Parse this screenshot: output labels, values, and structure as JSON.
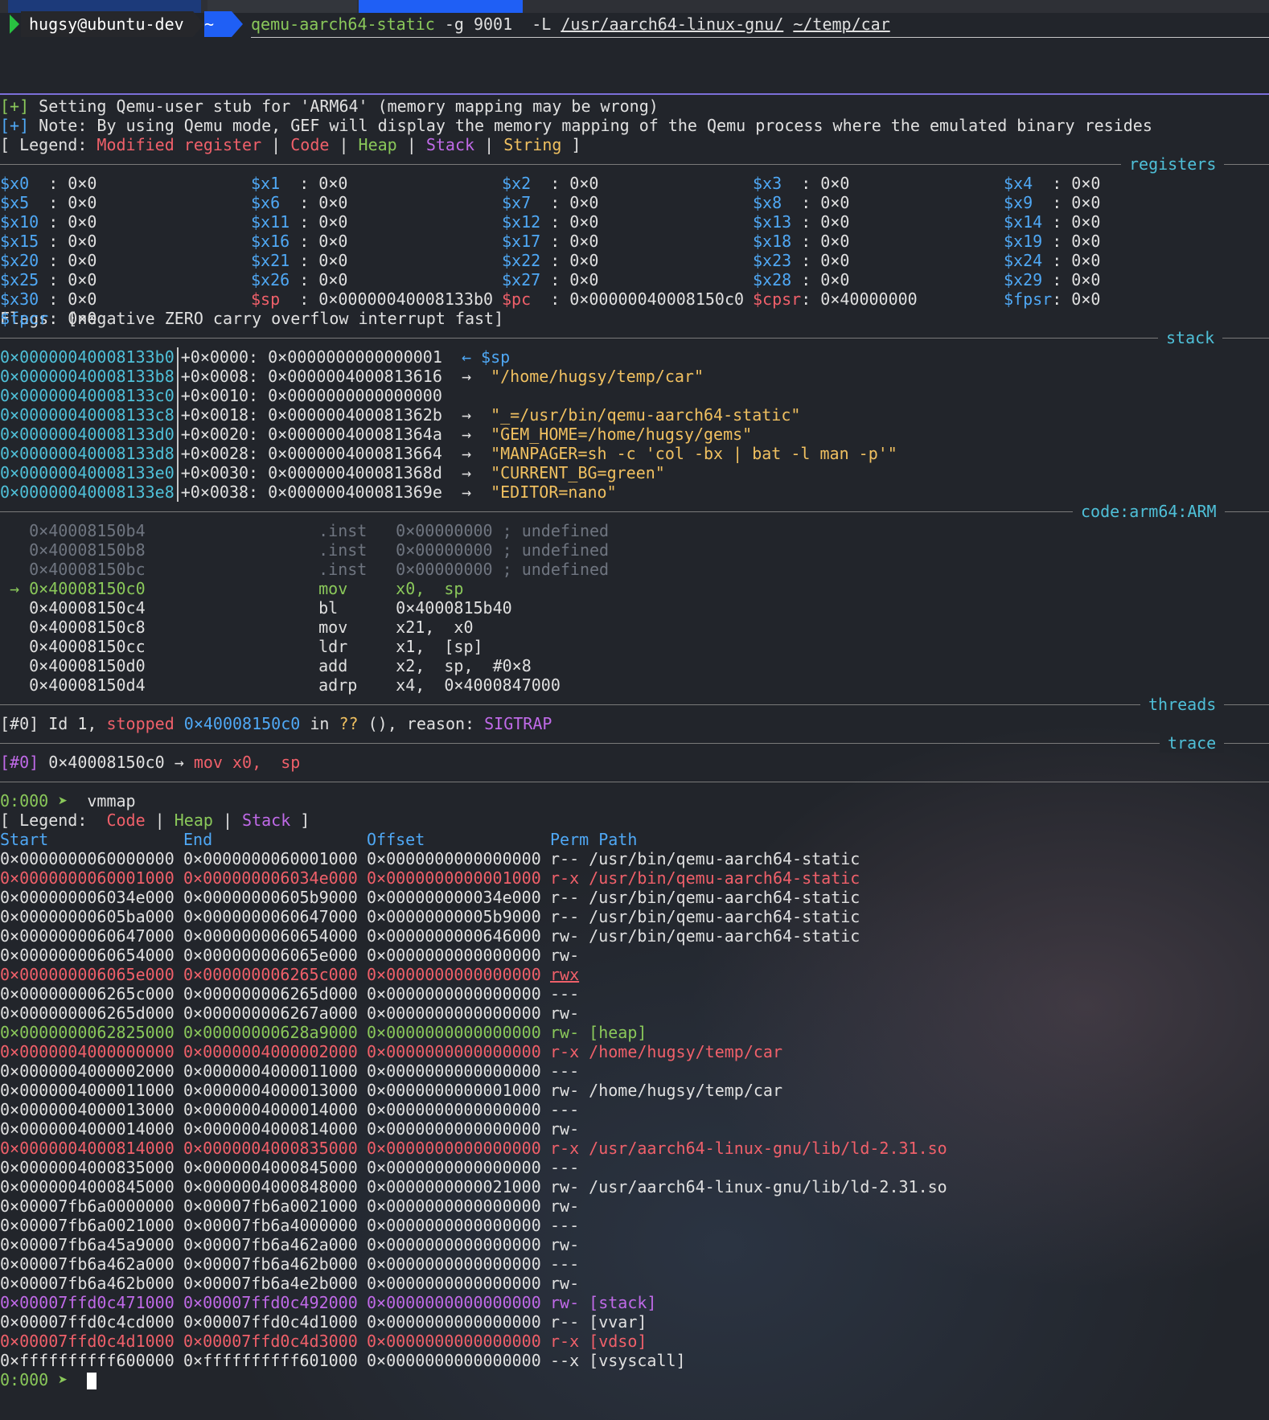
{
  "prompt": {
    "user_host": "hugsy@ubuntu-dev",
    "dir": "~",
    "cmd": "qemu-aarch64-static",
    "args1": " -g 9001  -L ",
    "arg_path1": "/usr/aarch64-linux-gnu/",
    "arg_path2": "~/temp/car"
  },
  "info_lines": [
    {
      "prefix": "[+]",
      "text": " Setting Qemu-user stub for 'ARM64' (memory mapping may be wrong)"
    },
    {
      "prefix": "[+]",
      "text": " Note: By using Qemu mode, GEF will display the memory mapping of the Qemu process where the emulated binary resides"
    }
  ],
  "legend": {
    "open": "[ Legend: ",
    "modified": "Modified register",
    "code": "Code",
    "heap": "Heap",
    "stack": "Stack",
    "string": "String",
    "close": " ]",
    "sep": " | "
  },
  "sections": {
    "registers": "registers",
    "stack": "stack",
    "code": "code:arm64:ARM",
    "threads": "threads",
    "trace": "trace"
  },
  "registers": [
    [
      {
        "n": "$x0  ",
        "v": ": 0×0"
      },
      {
        "n": "$x1  ",
        "v": ": 0×0"
      },
      {
        "n": "$x2  ",
        "v": ": 0×0"
      },
      {
        "n": "$x3  ",
        "v": ": 0×0"
      },
      {
        "n": "$x4  ",
        "v": ": 0×0"
      }
    ],
    [
      {
        "n": "$x5  ",
        "v": ": 0×0"
      },
      {
        "n": "$x6  ",
        "v": ": 0×0"
      },
      {
        "n": "$x7  ",
        "v": ": 0×0"
      },
      {
        "n": "$x8  ",
        "v": ": 0×0"
      },
      {
        "n": "$x9  ",
        "v": ": 0×0"
      }
    ],
    [
      {
        "n": "$x10 ",
        "v": ": 0×0"
      },
      {
        "n": "$x11 ",
        "v": ": 0×0"
      },
      {
        "n": "$x12 ",
        "v": ": 0×0"
      },
      {
        "n": "$x13 ",
        "v": ": 0×0"
      },
      {
        "n": "$x14 ",
        "v": ": 0×0"
      }
    ],
    [
      {
        "n": "$x15 ",
        "v": ": 0×0"
      },
      {
        "n": "$x16 ",
        "v": ": 0×0"
      },
      {
        "n": "$x17 ",
        "v": ": 0×0"
      },
      {
        "n": "$x18 ",
        "v": ": 0×0"
      },
      {
        "n": "$x19 ",
        "v": ": 0×0"
      }
    ],
    [
      {
        "n": "$x20 ",
        "v": ": 0×0"
      },
      {
        "n": "$x21 ",
        "v": ": 0×0"
      },
      {
        "n": "$x22 ",
        "v": ": 0×0"
      },
      {
        "n": "$x23 ",
        "v": ": 0×0"
      },
      {
        "n": "$x24 ",
        "v": ": 0×0"
      }
    ],
    [
      {
        "n": "$x25 ",
        "v": ": 0×0"
      },
      {
        "n": "$x26 ",
        "v": ": 0×0"
      },
      {
        "n": "$x27 ",
        "v": ": 0×0"
      },
      {
        "n": "$x28 ",
        "v": ": 0×0"
      },
      {
        "n": "$x29 ",
        "v": ": 0×0"
      }
    ],
    [
      {
        "n": "$x30 ",
        "v": ": 0×0"
      },
      {
        "n": "$sp  ",
        "v": ": 0×00000040008133b0",
        "mod": true
      },
      {
        "n": "$pc  ",
        "v": ": 0×00000040008150c0",
        "mod": true
      },
      {
        "n": "$cpsr",
        "v": ": 0×40000000",
        "mod": true
      },
      {
        "n": "$fpsr",
        "v": ": 0×0"
      }
    ],
    [
      {
        "n": "$fpcr",
        "v": ": 0×0"
      }
    ]
  ],
  "flags": "Flags: [negative ZERO carry overflow interrupt fast]",
  "stack_rows": [
    {
      "addr": "0×00000040008133b0",
      "off": "+0×0000: ",
      "val": "0×0000000000000001",
      "arrow": "  ← ",
      "ref": "$sp",
      "kind": "reg"
    },
    {
      "addr": "0×00000040008133b8",
      "off": "+0×0008: ",
      "val": "0×0000004000813616",
      "arrow": "  →  ",
      "ref": "\"/home/hugsy/temp/car\"",
      "kind": "str"
    },
    {
      "addr": "0×00000040008133c0",
      "off": "+0×0010: ",
      "val": "0×0000000000000000",
      "arrow": "",
      "ref": "",
      "kind": "none"
    },
    {
      "addr": "0×00000040008133c8",
      "off": "+0×0018: ",
      "val": "0×000000400081362b",
      "arrow": "  →  ",
      "ref": "\"_=/usr/bin/qemu-aarch64-static\"",
      "kind": "str"
    },
    {
      "addr": "0×00000040008133d0",
      "off": "+0×0020: ",
      "val": "0×000000400081364a",
      "arrow": "  →  ",
      "ref": "\"GEM_HOME=/home/hugsy/gems\"",
      "kind": "str"
    },
    {
      "addr": "0×00000040008133d8",
      "off": "+0×0028: ",
      "val": "0×0000004000813664",
      "arrow": "  →  ",
      "ref": "\"MANPAGER=sh -c 'col -bx | bat -l man -p'\"",
      "kind": "str"
    },
    {
      "addr": "0×00000040008133e0",
      "off": "+0×0030: ",
      "val": "0×000000400081368d",
      "arrow": "  →  ",
      "ref": "\"CURRENT_BG=green\"",
      "kind": "str"
    },
    {
      "addr": "0×00000040008133e8",
      "off": "+0×0038: ",
      "val": "0×000000400081369e",
      "arrow": "  →  ",
      "ref": "\"EDITOR=nano\"",
      "kind": "str"
    }
  ],
  "code_rows": [
    {
      "mark": "   ",
      "addr": "0×40008150b4",
      "mn": ".inst ",
      "ops": " 0×00000000 ; undefined",
      "state": "past"
    },
    {
      "mark": "   ",
      "addr": "0×40008150b8",
      "mn": ".inst ",
      "ops": " 0×00000000 ; undefined",
      "state": "past"
    },
    {
      "mark": "   ",
      "addr": "0×40008150bc",
      "mn": ".inst ",
      "ops": " 0×00000000 ; undefined",
      "state": "past"
    },
    {
      "mark": " → ",
      "addr": "0×40008150c0",
      "mn": "mov   ",
      "ops": " x0,  sp",
      "state": "cur"
    },
    {
      "mark": "   ",
      "addr": "0×40008150c4",
      "mn": "bl    ",
      "ops": " 0×4000815b40",
      "state": "next"
    },
    {
      "mark": "   ",
      "addr": "0×40008150c8",
      "mn": "mov   ",
      "ops": " x21,  x0",
      "state": "next"
    },
    {
      "mark": "   ",
      "addr": "0×40008150cc",
      "mn": "ldr   ",
      "ops": " x1,  [sp]",
      "state": "next"
    },
    {
      "mark": "   ",
      "addr": "0×40008150d0",
      "mn": "add   ",
      "ops": " x2,  sp,  #0×8",
      "state": "next"
    },
    {
      "mark": "   ",
      "addr": "0×40008150d4",
      "mn": "adrp  ",
      "ops": " x4,  0×4000847000",
      "state": "next"
    }
  ],
  "thread": {
    "id": "[#0]",
    "text1": " Id 1, ",
    "state": "stopped",
    "addr": " 0×40008150c0",
    "in": " in ",
    "fn": "??",
    "text2": " (), reason: ",
    "reason": "SIGTRAP"
  },
  "trace": {
    "id": "[#0]",
    "addr": " 0×40008150c0 → ",
    "insn": "mov x0,  sp"
  },
  "gef_prompt": "0:000 ➤ ",
  "command": " vmmap",
  "vm_legend": {
    "open": "[ Legend:  ",
    "code": "Code",
    "heap": "Heap",
    "stack": "Stack",
    "close": " ]"
  },
  "vm_header": {
    "start": "Start",
    "end": "End",
    "offset": "Offset",
    "perm": "Perm",
    "path": "Path"
  },
  "vm_rows": [
    {
      "start": "0×0000000060000000",
      "end": "0×0000000060001000",
      "offset": "0×0000000000000000",
      "perm": "r--",
      "path": "/usr/bin/qemu-aarch64-static",
      "kind": "plain"
    },
    {
      "start": "0×0000000060001000",
      "end": "0×000000006034e000",
      "offset": "0×0000000000001000",
      "perm": "r-x",
      "path": "/usr/bin/qemu-aarch64-static",
      "kind": "code"
    },
    {
      "start": "0×000000006034e000",
      "end": "0×00000000605b9000",
      "offset": "0×000000000034e000",
      "perm": "r--",
      "path": "/usr/bin/qemu-aarch64-static",
      "kind": "plain"
    },
    {
      "start": "0×00000000605ba000",
      "end": "0×0000000060647000",
      "offset": "0×00000000005b9000",
      "perm": "r--",
      "path": "/usr/bin/qemu-aarch64-static",
      "kind": "plain"
    },
    {
      "start": "0×0000000060647000",
      "end": "0×0000000060654000",
      "offset": "0×0000000000646000",
      "perm": "rw-",
      "path": "/usr/bin/qemu-aarch64-static",
      "kind": "plain"
    },
    {
      "start": "0×0000000060654000",
      "end": "0×000000006065e000",
      "offset": "0×0000000000000000",
      "perm": "rw-",
      "path": "",
      "kind": "plain"
    },
    {
      "start": "0×000000006065e000",
      "end": "0×000000006265c000",
      "offset": "0×0000000000000000",
      "perm": "rwx",
      "path": "",
      "kind": "rwx"
    },
    {
      "start": "0×000000006265c000",
      "end": "0×000000006265d000",
      "offset": "0×0000000000000000",
      "perm": "---",
      "path": "",
      "kind": "plain"
    },
    {
      "start": "0×000000006265d000",
      "end": "0×000000006267a000",
      "offset": "0×0000000000000000",
      "perm": "rw-",
      "path": "",
      "kind": "plain"
    },
    {
      "start": "0×0000000062825000",
      "end": "0×00000000628a9000",
      "offset": "0×0000000000000000",
      "perm": "rw-",
      "path": "[heap]",
      "kind": "heap"
    },
    {
      "start": "0×0000004000000000",
      "end": "0×0000004000002000",
      "offset": "0×0000000000000000",
      "perm": "r-x",
      "path": "/home/hugsy/temp/car",
      "kind": "code"
    },
    {
      "start": "0×0000004000002000",
      "end": "0×0000004000011000",
      "offset": "0×0000000000000000",
      "perm": "---",
      "path": "",
      "kind": "plain"
    },
    {
      "start": "0×0000004000011000",
      "end": "0×0000004000013000",
      "offset": "0×0000000000001000",
      "perm": "rw-",
      "path": "/home/hugsy/temp/car",
      "kind": "plain"
    },
    {
      "start": "0×0000004000013000",
      "end": "0×0000004000014000",
      "offset": "0×0000000000000000",
      "perm": "---",
      "path": "",
      "kind": "plain"
    },
    {
      "start": "0×0000004000014000",
      "end": "0×0000004000814000",
      "offset": "0×0000000000000000",
      "perm": "rw-",
      "path": "",
      "kind": "plain"
    },
    {
      "start": "0×0000004000814000",
      "end": "0×0000004000835000",
      "offset": "0×0000000000000000",
      "perm": "r-x",
      "path": "/usr/aarch64-linux-gnu/lib/ld-2.31.so",
      "kind": "code"
    },
    {
      "start": "0×0000004000835000",
      "end": "0×0000004000845000",
      "offset": "0×0000000000000000",
      "perm": "---",
      "path": "",
      "kind": "plain"
    },
    {
      "start": "0×0000004000845000",
      "end": "0×0000004000848000",
      "offset": "0×0000000000021000",
      "perm": "rw-",
      "path": "/usr/aarch64-linux-gnu/lib/ld-2.31.so",
      "kind": "plain"
    },
    {
      "start": "0×00007fb6a0000000",
      "end": "0×00007fb6a0021000",
      "offset": "0×0000000000000000",
      "perm": "rw-",
      "path": "",
      "kind": "plain"
    },
    {
      "start": "0×00007fb6a0021000",
      "end": "0×00007fb6a4000000",
      "offset": "0×0000000000000000",
      "perm": "---",
      "path": "",
      "kind": "plain"
    },
    {
      "start": "0×00007fb6a45a9000",
      "end": "0×00007fb6a462a000",
      "offset": "0×0000000000000000",
      "perm": "rw-",
      "path": "",
      "kind": "plain"
    },
    {
      "start": "0×00007fb6a462a000",
      "end": "0×00007fb6a462b000",
      "offset": "0×0000000000000000",
      "perm": "---",
      "path": "",
      "kind": "plain"
    },
    {
      "start": "0×00007fb6a462b000",
      "end": "0×00007fb6a4e2b000",
      "offset": "0×0000000000000000",
      "perm": "rw-",
      "path": "",
      "kind": "plain"
    },
    {
      "start": "0×00007ffd0c471000",
      "end": "0×00007ffd0c492000",
      "offset": "0×0000000000000000",
      "perm": "rw-",
      "path": "[stack]",
      "kind": "stack"
    },
    {
      "start": "0×00007ffd0c4cd000",
      "end": "0×00007ffd0c4d1000",
      "offset": "0×0000000000000000",
      "perm": "r--",
      "path": "[vvar]",
      "kind": "plain"
    },
    {
      "start": "0×00007ffd0c4d1000",
      "end": "0×00007ffd0c4d3000",
      "offset": "0×0000000000000000",
      "perm": "r-x",
      "path": "[vdso]",
      "kind": "code"
    },
    {
      "start": "0×ffffffffff600000",
      "end": "0×ffffffffff601000",
      "offset": "0×0000000000000000",
      "perm": "--x",
      "path": "[vsyscall]",
      "kind": "plain"
    }
  ]
}
